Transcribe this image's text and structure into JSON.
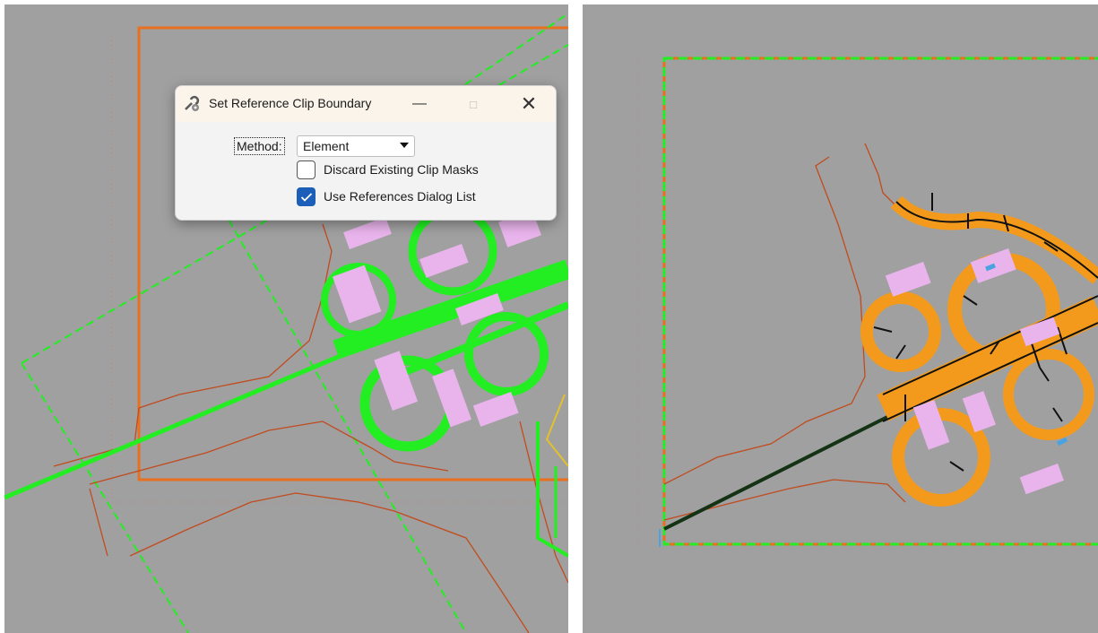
{
  "dialog": {
    "title": "Set Reference Clip Boundary",
    "icon": "wrench-gear-icon",
    "controls": {
      "minimize": "—",
      "maximize": "□",
      "close": "✕"
    },
    "method_label": "Method:",
    "method_value": "Element",
    "checkboxes": [
      {
        "label": "Discard Existing Clip Masks",
        "checked": false
      },
      {
        "label": "Use References Dialog List",
        "checked": true
      }
    ]
  },
  "colors": {
    "view_background": "#a0a0a0",
    "clip_boundary": "#e8701f",
    "reference_green": "#22ee22",
    "roads_orange": "#f39a1c",
    "annotation_pink": "#e9b4ec",
    "contour_brown": "#c14b1e",
    "checkbox_accent": "#1c5fb8"
  }
}
